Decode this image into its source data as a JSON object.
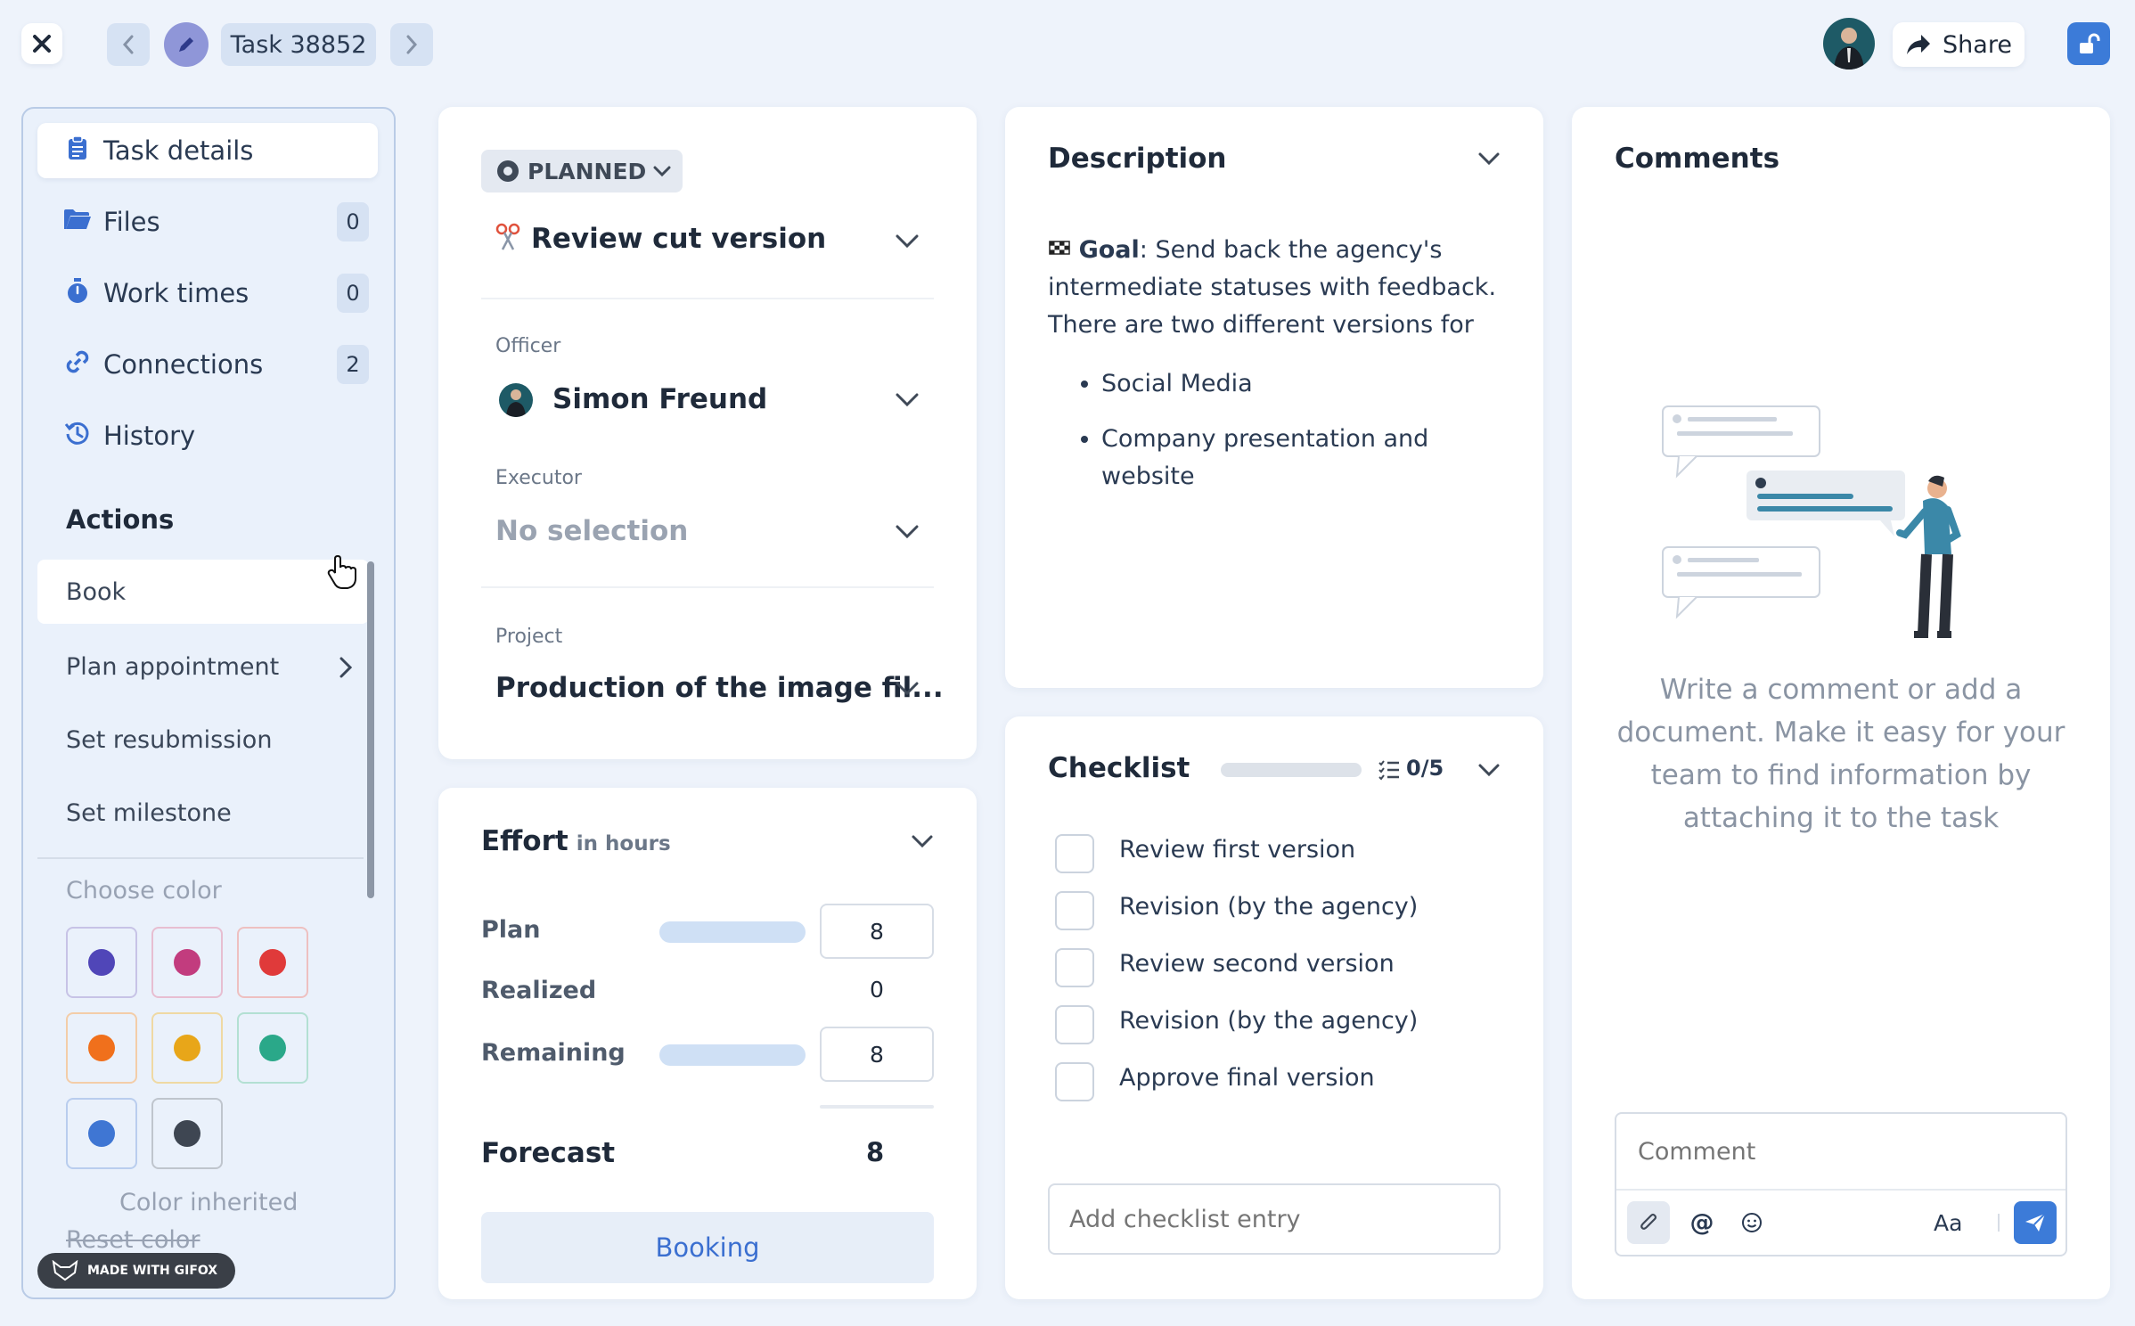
{
  "topbar": {
    "task_label": "Task 38852",
    "share_label": "Share"
  },
  "sidebar": {
    "items": [
      {
        "label": "Task details",
        "icon": "clipboard-icon"
      },
      {
        "label": "Files",
        "count": "0",
        "icon": "folder-icon"
      },
      {
        "label": "Work times",
        "count": "0",
        "icon": "stopwatch-icon"
      },
      {
        "label": "Connections",
        "count": "2",
        "icon": "link-icon"
      },
      {
        "label": "History",
        "icon": "history-icon"
      }
    ],
    "actions_heading": "Actions",
    "actions": [
      "Book",
      "Plan appointment",
      "Set resubmission",
      "Set milestone"
    ],
    "choose_color": "Choose color",
    "colors": [
      "#5046b8",
      "#c23c7e",
      "#e03a3a",
      "#f0701c",
      "#e8a619",
      "#2aa889",
      "#3f76d3",
      "#3e4652"
    ],
    "color_inherited": "Color inherited",
    "reset_color": "Reset color",
    "badge": "MADE WITH GIFOX"
  },
  "task": {
    "status": "PLANNED",
    "title": "Review cut version",
    "officer_label": "Officer",
    "officer": "Simon Freund",
    "executor_label": "Executor",
    "executor": "No selection",
    "project_label": "Project",
    "project": "Production of the image fil..."
  },
  "effort": {
    "title": "Effort",
    "unit": "in hours",
    "plan_label": "Plan",
    "plan_value": "8",
    "realized_label": "Realized",
    "realized_value": "0",
    "remaining_label": "Remaining",
    "remaining_value": "8",
    "forecast_label": "Forecast",
    "forecast_value": "8",
    "booking_label": "Booking"
  },
  "description": {
    "title": "Description",
    "goal_label": "Goal",
    "goal_text": ": Send back the agency's intermediate statuses with feedback. There are two different versions for",
    "bullets": [
      "Social Media",
      "Company presentation and website"
    ]
  },
  "checklist": {
    "title": "Checklist",
    "progress": "0/5",
    "progress_fraction": 0,
    "items": [
      "Review first version",
      "Revision (by the agency)",
      "Review second version",
      "Revision (by the agency)",
      "Approve final version"
    ],
    "add_placeholder": "Add checklist entry"
  },
  "comments": {
    "title": "Comments",
    "empty_text": "Write a comment or add a document. Make it easy for your team to find information by attaching it to the task",
    "input_placeholder": "Comment",
    "format_label": "Aa"
  }
}
